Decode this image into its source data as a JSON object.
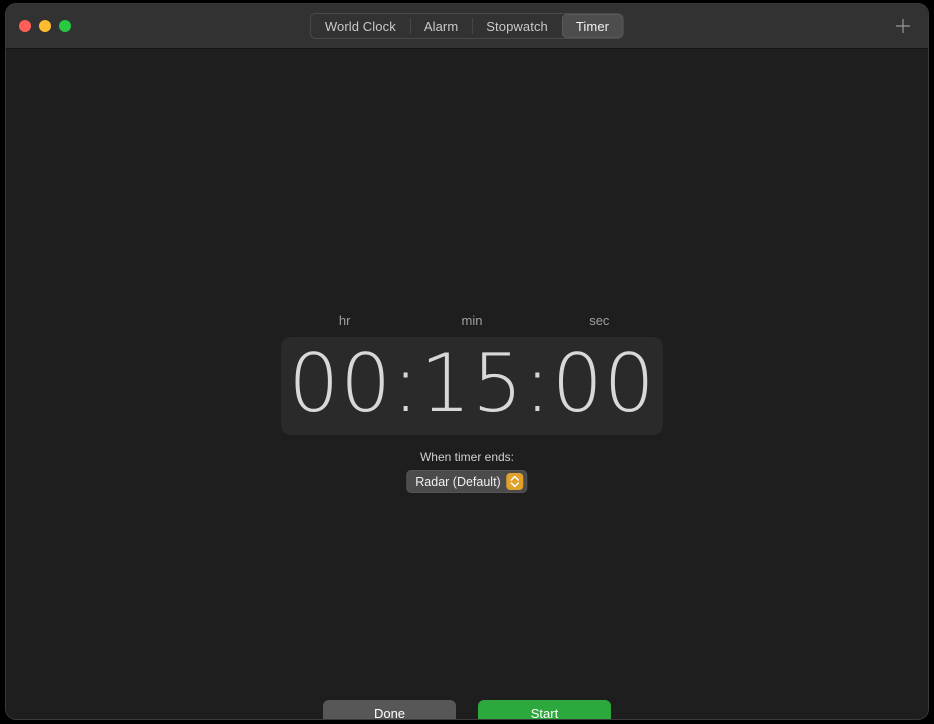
{
  "window": {
    "traffic_lights": [
      {
        "name": "close",
        "color": "#ff5f57"
      },
      {
        "name": "minimize",
        "color": "#febc2e"
      },
      {
        "name": "zoom",
        "color": "#28c840"
      }
    ]
  },
  "tabs": [
    {
      "label": "World Clock",
      "selected": false
    },
    {
      "label": "Alarm",
      "selected": false
    },
    {
      "label": "Stopwatch",
      "selected": false
    },
    {
      "label": "Timer",
      "selected": true
    }
  ],
  "toolbar": {
    "add_icon": "plus-icon"
  },
  "timer": {
    "unit_labels": [
      "hr",
      "min",
      "sec"
    ],
    "display": "00:15:00",
    "hours": "00",
    "minutes": "15",
    "seconds": "00"
  },
  "sound": {
    "label": "When timer ends:",
    "selected_option": "Radar (Default)",
    "chevron_color": "#e2a12a"
  },
  "footer": {
    "done_label": "Done",
    "start_label": "Start",
    "start_color": "#2ca83d",
    "done_color": "#575757"
  }
}
